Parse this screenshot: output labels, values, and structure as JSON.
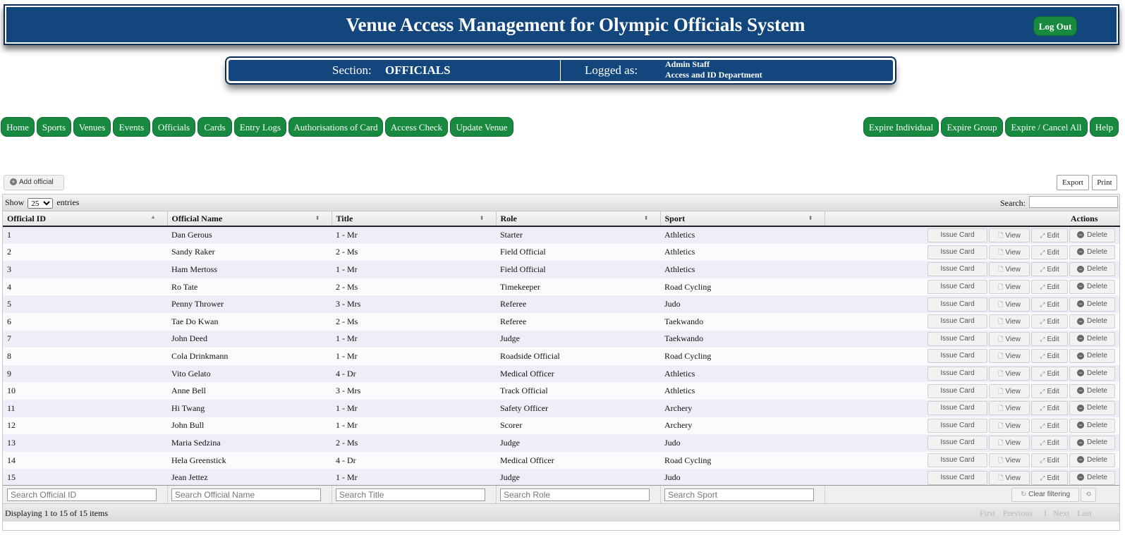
{
  "header": {
    "title": "Venue Access Management for Olympic Officials System",
    "logout_label": "Log Out"
  },
  "infobar": {
    "section_label": "Section:",
    "section_value": "OFFICIALS",
    "logged_label": "Logged as:",
    "user": "Admin Staff",
    "department": "Access and ID Department"
  },
  "nav": {
    "left": [
      "Home",
      "Sports",
      "Venues",
      "Events",
      "Officials",
      "Cards",
      "Entry Logs",
      "Authorisations of Card",
      "Access Check",
      "Update Venue"
    ],
    "right": [
      "Expire Individual",
      "Expire Group",
      "Expire / Cancel All",
      "Help"
    ]
  },
  "toolbar": {
    "add_label": "Add official",
    "export_label": "Export",
    "print_label": "Print",
    "show_label": "Show",
    "page_size": "25",
    "entries_label": "entries",
    "search_label": "Search:"
  },
  "table": {
    "columns": [
      "Official ID",
      "Official Name",
      "Title",
      "Role",
      "Sport",
      "Actions"
    ],
    "action_labels": [
      "Issue Card",
      "View",
      "Edit",
      "Delete"
    ],
    "rows": [
      [
        "1",
        "Dan Gerous",
        "1 - Mr",
        "Starter",
        "Athletics"
      ],
      [
        "2",
        "Sandy Raker",
        "2 - Ms",
        "Field Official",
        "Athletics"
      ],
      [
        "3",
        "Ham Mertoss",
        "1 - Mr",
        "Field Official",
        "Athletics"
      ],
      [
        "4",
        "Ro Tate",
        "2 - Ms",
        "Timekeeper",
        "Road Cycling"
      ],
      [
        "5",
        "Penny Thrower",
        "3 - Mrs",
        "Referee",
        "Judo"
      ],
      [
        "6",
        "Tae Do Kwan",
        "2 - Ms",
        "Referee",
        "Taekwando"
      ],
      [
        "7",
        "John Deed",
        "1 - Mr",
        "Judge",
        "Taekwando"
      ],
      [
        "8",
        "Cola Drinkmann",
        "1 - Mr",
        "Roadside Official",
        "Road Cycling"
      ],
      [
        "9",
        "Vito Gelato",
        "4 - Dr",
        "Medical Officer",
        "Athletics"
      ],
      [
        "10",
        "Anne Bell",
        "3 - Mrs",
        "Track Official",
        "Athletics"
      ],
      [
        "11",
        "Hi Twang",
        "1 - Mr",
        "Safety Officer",
        "Archery"
      ],
      [
        "12",
        "John Bull",
        "1 - Mr",
        "Scorer",
        "Archery"
      ],
      [
        "13",
        "Maria Sedzina",
        "2 - Ms",
        "Judge",
        "Judo"
      ],
      [
        "14",
        "Hela Greenstick",
        "4 - Dr",
        "Medical Officer",
        "Road Cycling"
      ],
      [
        "15",
        "Jean Jettez",
        "1 - Mr",
        "Judge",
        "Judo"
      ]
    ]
  },
  "filters": {
    "placeholders": [
      "Search Official ID",
      "Search Official Name",
      "Search Title",
      "Search Role",
      "Search Sport"
    ],
    "clear_label": "Clear filtering"
  },
  "footer": {
    "info": "Displaying 1 to 15 of 15 items",
    "pager": [
      "First",
      "Previous",
      "1",
      "Next",
      "Last"
    ]
  }
}
